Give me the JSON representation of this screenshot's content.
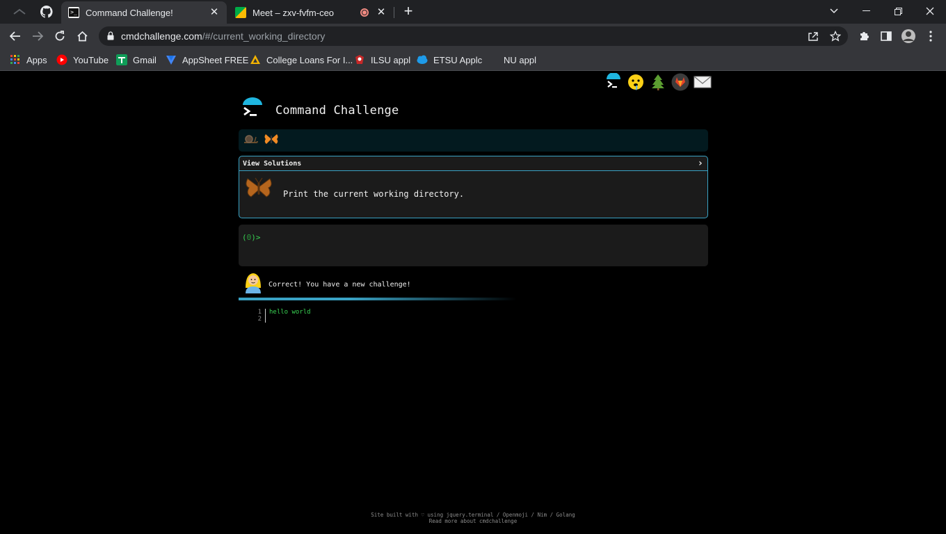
{
  "browser": {
    "tabs": [
      {
        "title": "Command Challenge!",
        "active": true
      },
      {
        "title": "Meet – zxv-fvfm-ceo",
        "active": false
      }
    ],
    "url": {
      "host": "cmdchallenge.com",
      "path": "/#/current_working_directory"
    },
    "bookmarks": [
      {
        "label": "Apps",
        "icon": "apps-grid-icon"
      },
      {
        "label": "YouTube",
        "icon": "youtube-icon"
      },
      {
        "label": "Gmail",
        "icon": "gmail-icon"
      },
      {
        "label": "AppSheet FREE",
        "icon": "appsheet-icon"
      },
      {
        "label": "College Loans For I...",
        "icon": "college-loans-icon"
      },
      {
        "label": "ILSU appl",
        "icon": "ilsu-icon"
      },
      {
        "label": "ETSU Applc",
        "icon": "etsu-icon"
      },
      {
        "label": "NU appl",
        "icon": ""
      }
    ]
  },
  "page": {
    "site_title": "Command Challenge",
    "card": {
      "heading": "View Solutions",
      "description": "Print the current working directory."
    },
    "terminal": {
      "prompt_open": "(",
      "prompt_count": "0",
      "prompt_close": ")>"
    },
    "message": "Correct! You have a new challenge!",
    "editor": {
      "lines": [
        {
          "n": "1",
          "text": "hello world"
        },
        {
          "n": "2",
          "text": ""
        }
      ]
    },
    "footer": {
      "line1": "Site built with ♡ using jquery.terminal / Openmoji / Nim / Golang",
      "line2": "Read more about cmdchallenge"
    }
  },
  "colors": {
    "accent": "#3aa3c5",
    "prompt_green": "#39d353",
    "card_bg": "#1b1b1b",
    "badge_bar": "#031a1f"
  }
}
